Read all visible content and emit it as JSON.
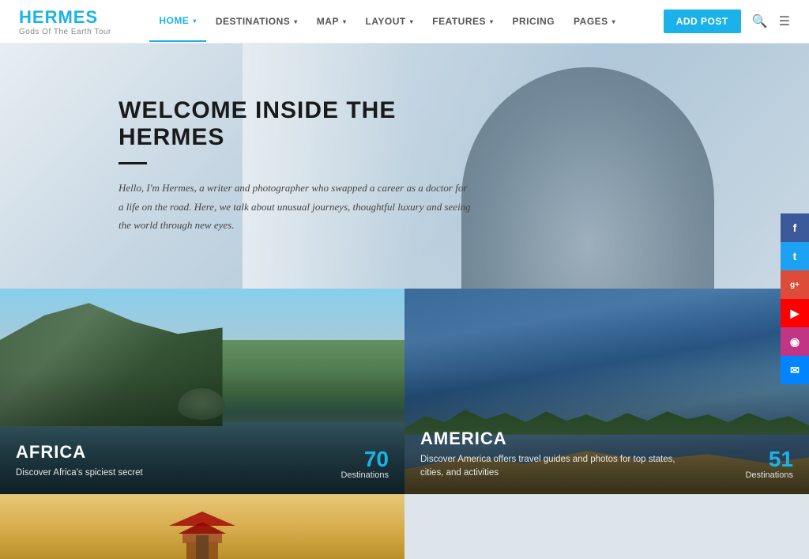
{
  "header": {
    "logo": {
      "title_h": "H",
      "title_rest": "ERMES",
      "subtitle": "Gods Of The Earth Tour"
    },
    "nav": [
      {
        "label": "HOME",
        "active": true,
        "has_dropdown": true
      },
      {
        "label": "DESTINATIONS",
        "active": false,
        "has_dropdown": true
      },
      {
        "label": "MAP",
        "active": false,
        "has_dropdown": true
      },
      {
        "label": "LAYOUT",
        "active": false,
        "has_dropdown": true
      },
      {
        "label": "FEATURES",
        "active": false,
        "has_dropdown": true
      },
      {
        "label": "PRICING",
        "active": false,
        "has_dropdown": false
      },
      {
        "label": "PAGES",
        "active": false,
        "has_dropdown": true
      }
    ],
    "add_post_label": "ADD POST"
  },
  "hero": {
    "title": "WELCOME INSIDE THE HERMES",
    "body": "Hello, I'm Hermes, a writer and photographer who swapped a career as a doctor for a life on the road. Here, we talk about unusual journeys, thoughtful luxury and seeing the world through new eyes."
  },
  "social": [
    {
      "id": "facebook",
      "symbol": "f"
    },
    {
      "id": "twitter",
      "symbol": "t"
    },
    {
      "id": "google-plus",
      "symbol": "g+"
    },
    {
      "id": "youtube",
      "symbol": "▶"
    },
    {
      "id": "instagram",
      "symbol": "◉"
    },
    {
      "id": "mail",
      "symbol": "✉"
    }
  ],
  "cards": [
    {
      "id": "africa",
      "title": "AFRICA",
      "desc": "Discover Africa's spiciest secret",
      "count": "70",
      "count_label": "Destinations"
    },
    {
      "id": "america",
      "title": "AMERICA",
      "desc": "Discover America offers travel guides and photos for top states, cities, and activities",
      "count": "51",
      "count_label": "Destinations"
    }
  ]
}
